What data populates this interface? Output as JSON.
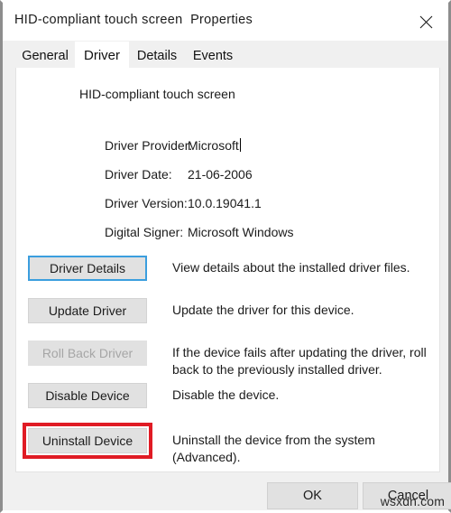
{
  "window": {
    "title": "HID-compliant touch screen  Properties",
    "close_icon": "close-icon"
  },
  "tabs": [
    {
      "label": "General",
      "active": false
    },
    {
      "label": "Driver",
      "active": true
    },
    {
      "label": "Details",
      "active": false
    },
    {
      "label": "Events",
      "active": false
    }
  ],
  "driver_tab": {
    "device_name": "HID-compliant touch screen",
    "info_rows": [
      {
        "label": "Driver Provider:",
        "value": "Microsoft",
        "caret": true
      },
      {
        "label": "Driver Date:",
        "value": "21-06-2006",
        "caret": false
      },
      {
        "label": "Driver Version:",
        "value": "10.0.19041.1",
        "caret": false
      },
      {
        "label": "Digital Signer:",
        "value": "Microsoft Windows",
        "caret": false
      }
    ],
    "actions": [
      {
        "button": "Driver Details",
        "description": "View details about the installed driver files.",
        "state": "focused"
      },
      {
        "button": "Update Driver",
        "description": "Update the driver for this device.",
        "state": "normal"
      },
      {
        "button": "Roll Back Driver",
        "description": "If the device fails after updating the driver, roll back to the previously installed driver.",
        "state": "disabled"
      },
      {
        "button": "Disable Device",
        "description": "Disable the device.",
        "state": "normal"
      },
      {
        "button": "Uninstall Device",
        "description": "Uninstall the device from the system (Advanced).",
        "state": "highlighted"
      }
    ]
  },
  "footer": {
    "ok_label": "OK",
    "cancel_label": "Cancel"
  },
  "watermark": "wsxdn.com",
  "colors": {
    "highlight_red": "#e01b24",
    "focus_blue": "#3b9ede",
    "button_face": "#e1e1e1",
    "dialog_face": "#f0f0f0"
  }
}
